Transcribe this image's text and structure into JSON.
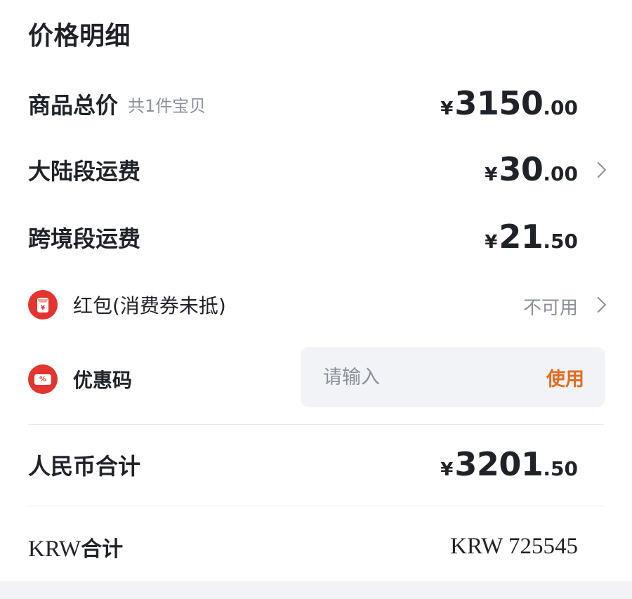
{
  "title": "价格明细",
  "rows": {
    "goods_total": {
      "label": "商品总价",
      "sub": "共1件宝贝",
      "currency": "¥",
      "integer": "3150",
      "decimal": ".00"
    },
    "mainland_shipping": {
      "label": "大陆段运费",
      "currency": "¥",
      "integer": "30",
      "decimal": ".00"
    },
    "crossborder_shipping": {
      "label": "跨境段运费",
      "currency": "¥",
      "integer": "21",
      "decimal": ".50"
    },
    "red_packet": {
      "label": "红包(消费券未抵)",
      "status": "不可用",
      "icon": "red-packet-icon",
      "icon_symbol": "¥"
    },
    "promo_code": {
      "label": "优惠码",
      "placeholder": "请输入",
      "use_label": "使用",
      "icon": "coupon-icon",
      "icon_symbol": "%"
    },
    "rmb_total": {
      "label": "人民币合计",
      "currency": "¥",
      "integer": "3201",
      "decimal": ".50"
    },
    "krw_total": {
      "label_latin": "KRW",
      "label_cn": "合计",
      "value": "KRW 725545"
    }
  },
  "colors": {
    "accent_orange": "#e36b1f",
    "icon_red": "#e3342f",
    "muted_text": "#8a9099",
    "primary_text": "#1f2329"
  }
}
